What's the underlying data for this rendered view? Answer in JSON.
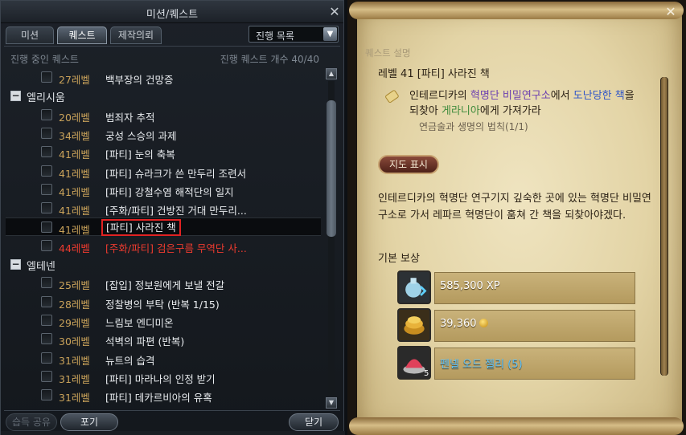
{
  "left": {
    "title": "미션/퀘스트",
    "tabs": [
      "미션",
      "퀘스트",
      "제작의뢰"
    ],
    "filter_select": "진행 목록",
    "list_header": "진행 중인 퀘스트",
    "quest_count_label": "진행 퀘스트 개수 40/40",
    "rows": [
      {
        "type": "quest",
        "level": "27레벨",
        "name": "백부장의 건망증"
      },
      {
        "type": "group",
        "name": "엘리시움"
      },
      {
        "type": "quest",
        "level": "20레벨",
        "name": "범죄자 추적"
      },
      {
        "type": "quest",
        "level": "34레벨",
        "name": "궁성 스승의 과제"
      },
      {
        "type": "quest",
        "level": "41레벨",
        "name": "[파티] 눈의 축복"
      },
      {
        "type": "quest",
        "level": "41레벨",
        "name": "[파티] 슈라크가 쓴 만두리 조련서"
      },
      {
        "type": "quest",
        "level": "41레벨",
        "name": "[파티] 강철수염 해적단의 일지"
      },
      {
        "type": "quest",
        "level": "41레벨",
        "name": "[주화/파티] 건방진 거대 만두리..."
      },
      {
        "type": "quest",
        "level": "41레벨",
        "name": "[파티] 사라진 책",
        "selected": true
      },
      {
        "type": "quest",
        "level": "44레벨",
        "name": "[주화/파티] 검은구름 무역단 사...",
        "red": true
      },
      {
        "type": "group",
        "name": "엘테넨"
      },
      {
        "type": "quest",
        "level": "25레벨",
        "name": "[잡입] 정보원에게 보낼 전갈"
      },
      {
        "type": "quest",
        "level": "28레벨",
        "name": "정찰병의 부탁 (반복 1/15)"
      },
      {
        "type": "quest",
        "level": "29레벨",
        "name": "느림보 엔디미온"
      },
      {
        "type": "quest",
        "level": "30레벨",
        "name": "석벽의 파편 (반복)"
      },
      {
        "type": "quest",
        "level": "31레벨",
        "name": "뉴트의 습격"
      },
      {
        "type": "quest",
        "level": "31레벨",
        "name": "[파티] 마라나의 인정 받기"
      },
      {
        "type": "quest",
        "level": "31레벨",
        "name": "[파티] 데카르비아의 유혹"
      }
    ],
    "buttons": {
      "share": "습득 공유",
      "abandon": "포기",
      "close": "닫기"
    },
    "bottom_text": "..."
  },
  "right": {
    "section_title": "퀘스트 설명",
    "quest_title": "레벨 41 [파티] 사라진 책",
    "objective": {
      "p1": "인테르디카의 ",
      "place": "혁명단 비밀연구소",
      "p2": "에서 ",
      "item": "도난당한 책",
      "p3": "을 되찾아 ",
      "npc": "게라니아",
      "p4": "에게 가져가라"
    },
    "sub_objective": "연금술과 생명의 법칙(1/1)",
    "map_button": "지도 표시",
    "description": "인테르디카의 혁명단 연구기지 깊숙한 곳에 있는 혁명단 비밀연구소로 가서 레파르 혁명단이 훔쳐 간 책을 되찾아야겠다.",
    "reward_title": "기본 보상",
    "rewards": {
      "xp": "585,300 XP",
      "kinah": "39,360",
      "item": "펜넬 오드 젤리 (5)",
      "item_qty": "5"
    }
  }
}
